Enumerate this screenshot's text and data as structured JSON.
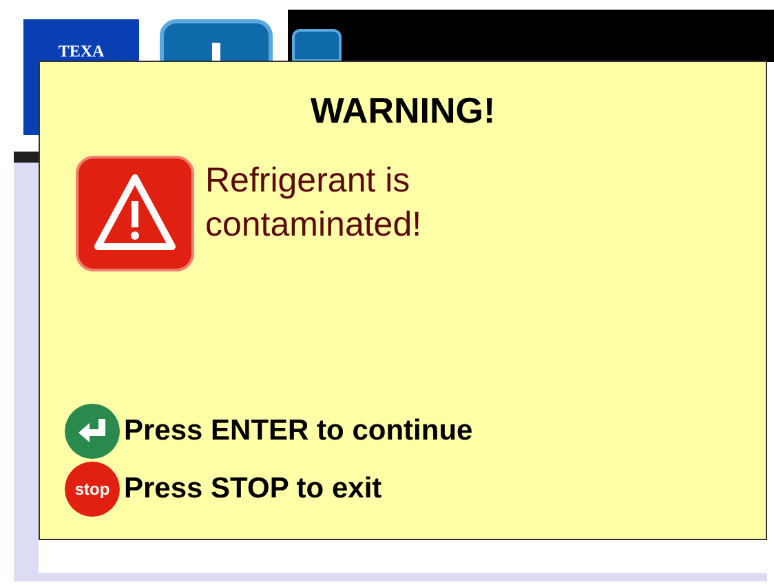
{
  "header": {
    "logo_text": "TEXA"
  },
  "dialog": {
    "title": "WARNING!",
    "message": "Refrigerant is contaminated!",
    "actions": [
      {
        "kind": "enter",
        "label": "Press ENTER to continue"
      },
      {
        "kind": "stop",
        "icon_text": "stop",
        "label": "Press STOP to exit"
      }
    ]
  }
}
